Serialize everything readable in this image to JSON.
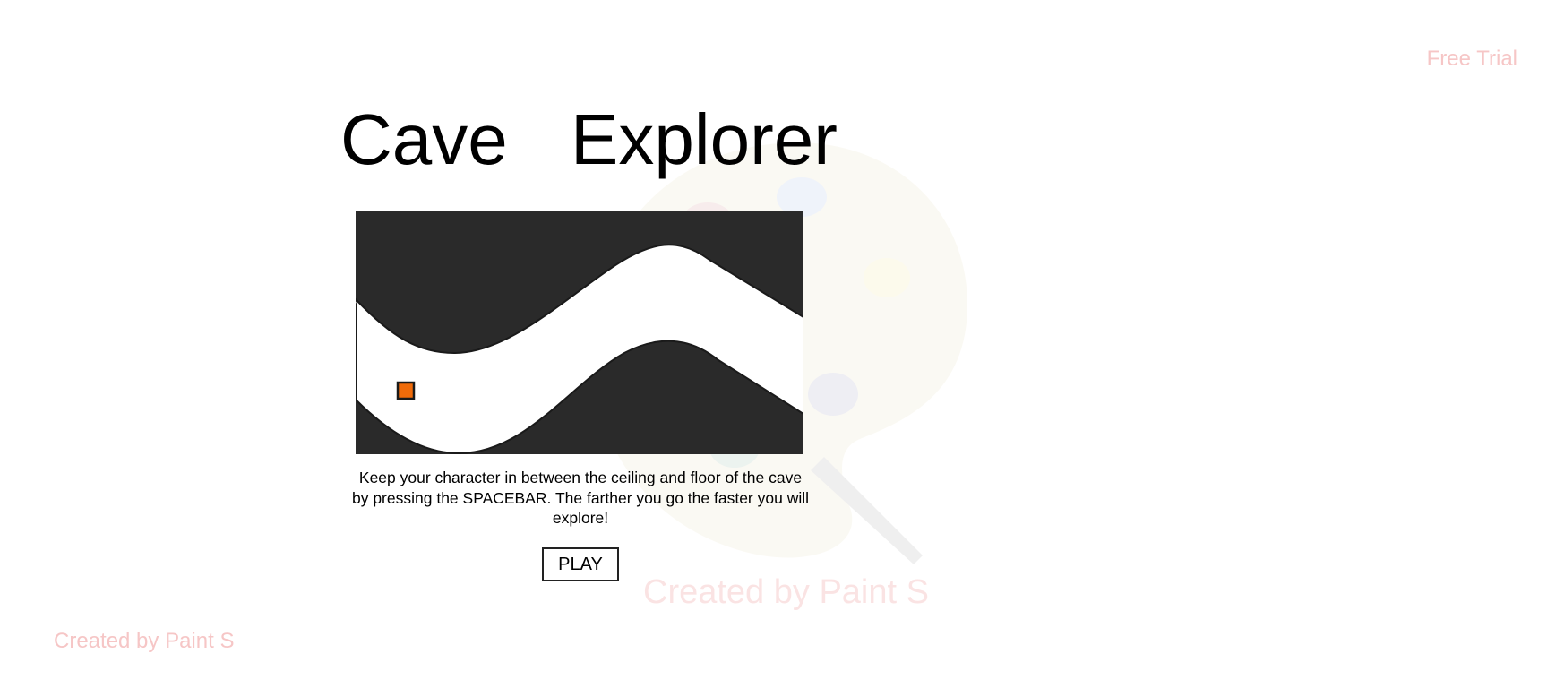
{
  "header": {
    "free_trial_label": "Free Trial"
  },
  "game": {
    "title": "Cave Explorer",
    "instructions": "Keep your character in between the ceiling and floor of the cave by pressing the SPACEBAR. The farther you go the faster you will explore!",
    "play_label": "PLAY"
  },
  "watermark": {
    "text": "Created by Paint S"
  },
  "footer": {
    "credit": "Created by Paint S"
  },
  "colors": {
    "cave_rock": "#2a2a2a",
    "tunnel": "#ffffff",
    "player": "#f06b0a",
    "credit_text": "#f6c6c6"
  }
}
